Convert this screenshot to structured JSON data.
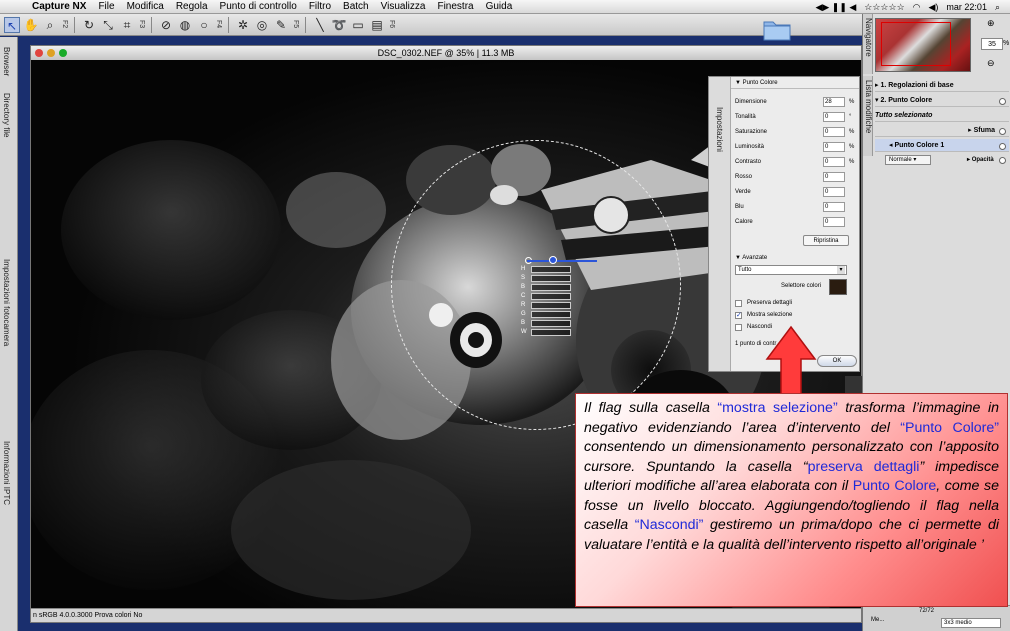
{
  "menubar": {
    "app": "Capture NX",
    "items": [
      "File",
      "Modifica",
      "Regola",
      "Punto di controllo",
      "Filtro",
      "Batch",
      "Visualizza",
      "Finestra",
      "Guida"
    ],
    "time": "mar 22:01"
  },
  "toolbar": {
    "fkeys": [
      "F2",
      "F3",
      "F4",
      "F5",
      "F6"
    ]
  },
  "left_sidebar": {
    "tabs": [
      "Browser",
      "Directory file",
      "Impostazioni fotocamera",
      "Informazioni IPTC"
    ]
  },
  "document": {
    "title": "DSC_0302.NEF @ 35% | 11.3 MB",
    "status": "n sRGB 4.0.0.3000 Prova colori No"
  },
  "control_point": {
    "letters": [
      "H",
      "S",
      "B",
      "C",
      "R",
      "G",
      "B",
      "W"
    ]
  },
  "punto_colore_panel": {
    "side_tab": "Impostazioni",
    "title": "Punto Colore",
    "rows": [
      {
        "label": "Dimensione",
        "value": "28",
        "unit": "%"
      },
      {
        "label": "Tonalità",
        "value": "0",
        "unit": "°"
      },
      {
        "label": "Saturazione",
        "value": "0",
        "unit": "%"
      },
      {
        "label": "Luminosità",
        "value": "0",
        "unit": "%"
      },
      {
        "label": "Contrasto",
        "value": "0",
        "unit": "%"
      },
      {
        "label": "Rosso",
        "value": "0",
        "unit": ""
      },
      {
        "label": "Verde",
        "value": "0",
        "unit": ""
      },
      {
        "label": "Blu",
        "value": "0",
        "unit": ""
      },
      {
        "label": "Calore",
        "value": "0",
        "unit": ""
      }
    ],
    "reset_label": "Ripristina",
    "advanced_label": "Avanzate",
    "select_value": "Tutto",
    "color_picker_label": "Selettore colori",
    "swatch_color": "#2a1c10",
    "checks": [
      {
        "label": "Preserva dettagli",
        "checked": false
      },
      {
        "label": "Mostra selezione",
        "checked": true
      },
      {
        "label": "Nascondi",
        "checked": false
      }
    ],
    "count_text": "1 punto di contr",
    "ok_label": "OK"
  },
  "right_panel": {
    "navigator_tab": "Navigatore",
    "zoom": "35",
    "zoom_unit": "%",
    "list_tab": "Lista modifiche",
    "rows": {
      "base": "1. Regolazioni di base",
      "pc": "2. Punto Colore",
      "all_selected": "Tutto selezionato",
      "sfuma": "Sfuma",
      "cp1": "Punto Colore 1",
      "blend": "Normale",
      "opacity": "Opacità"
    },
    "bottom": {
      "count": "72/72",
      "mode": "3x3 medio",
      "me": "Me..."
    }
  },
  "annotation": {
    "p1": "Il flag sulla casella ",
    "h1": "“mostra selezione”",
    "p2": " trasforma l’immagine in negativo evidenziando l’area d’intervento del ",
    "h2": "“Punto Colore”",
    "p3": " consentendo un dimensionamento personalizzato con l’apposito cursore. Spuntando la casella “",
    "h3": "preserva dettagli",
    "p4": "” impedisce ulteriori modifiche all’area elaborata con il ",
    "h4": "Punto Colore",
    "p5": ", come se fosse un livello bloccato. Aggiungendo/togliendo il flag nella casella ",
    "h5": "“Nascondi”",
    "p6": " gestiremo un prima/dopo che ci permette di valuatare l’entità e la qualità dell’intervento rispetto all’originale ’"
  }
}
